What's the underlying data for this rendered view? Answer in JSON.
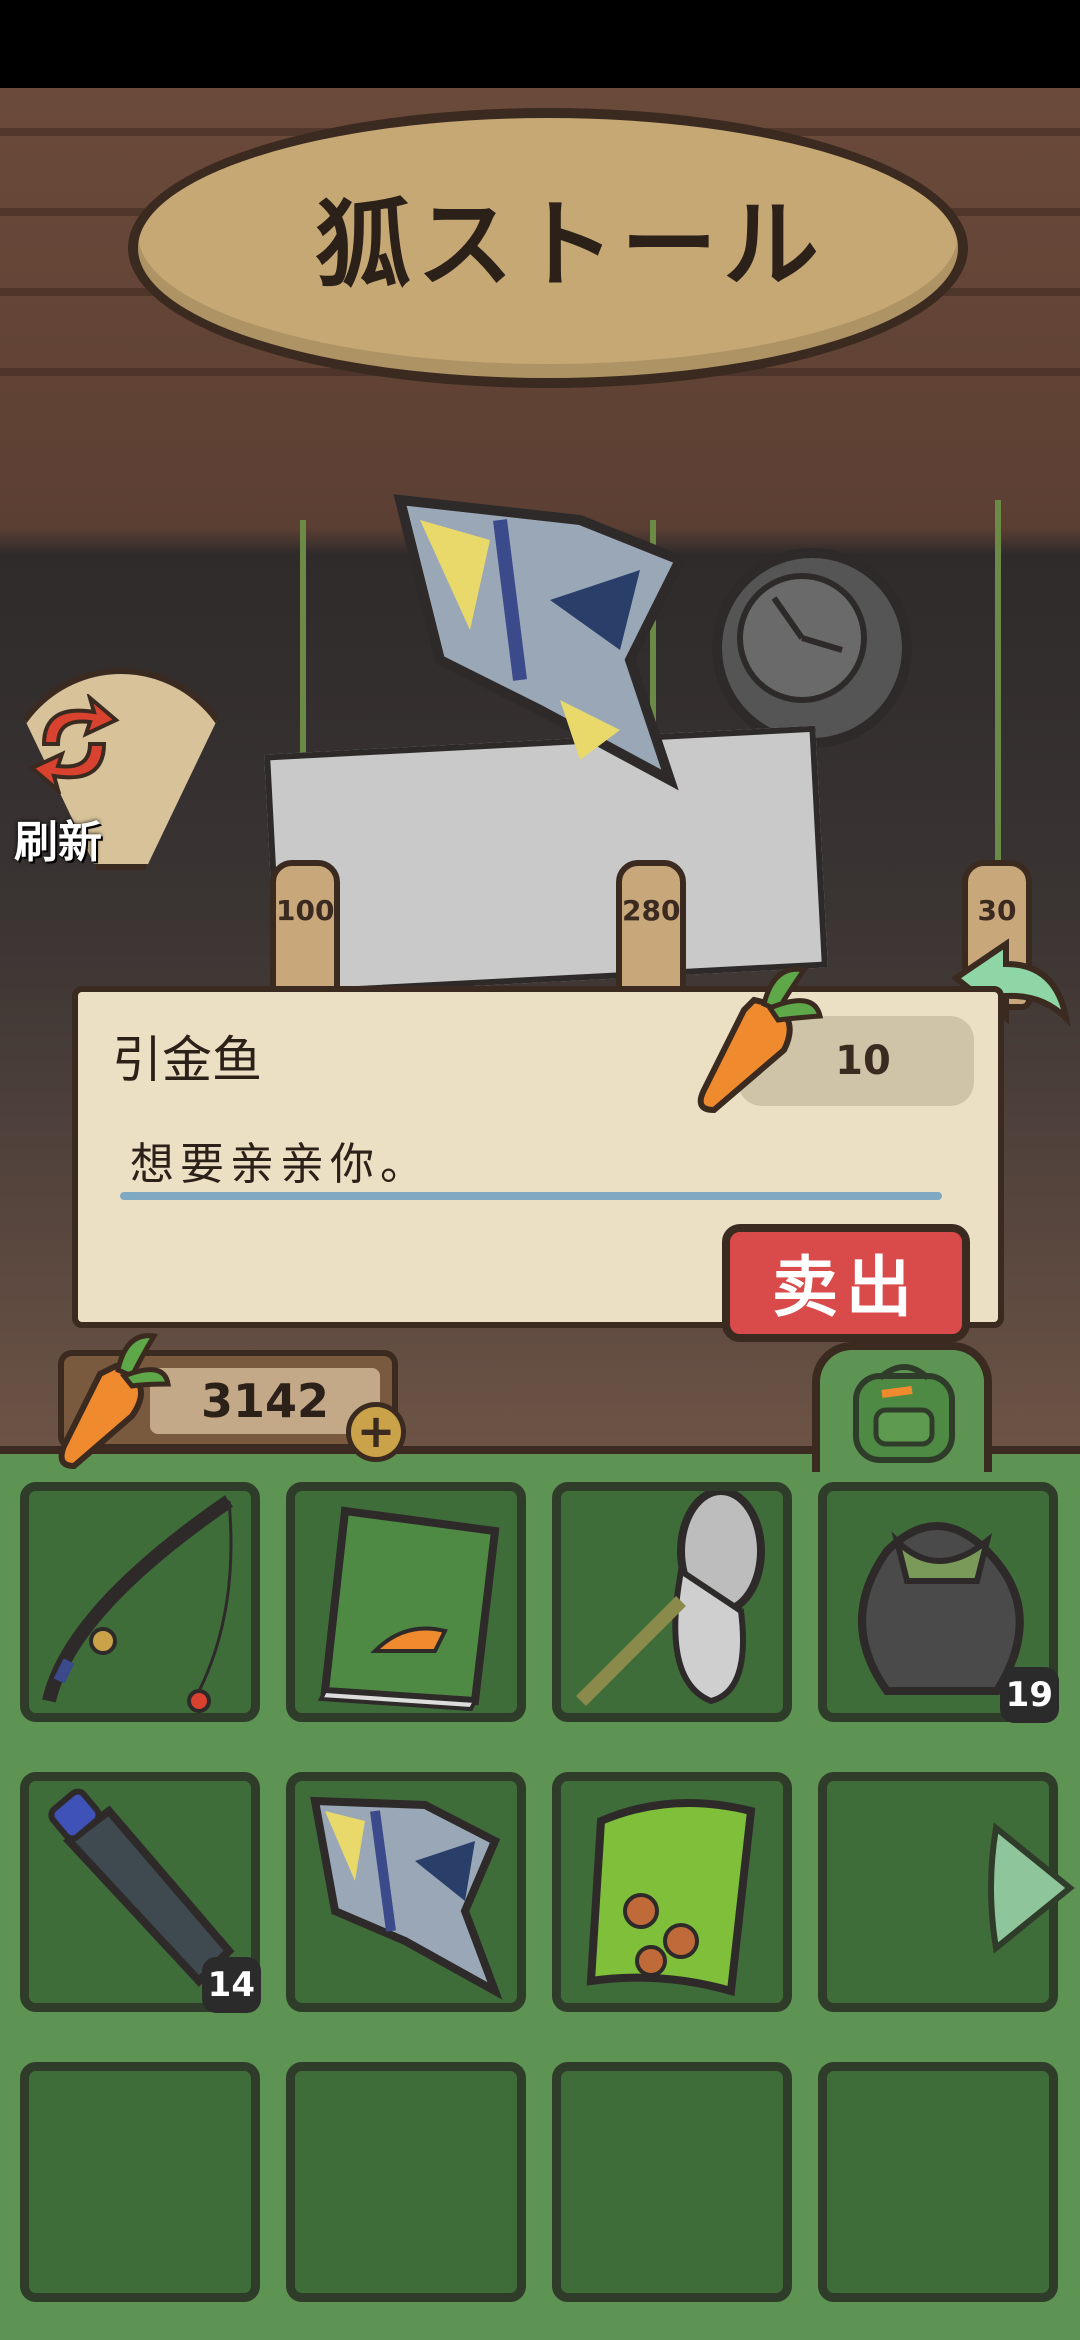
{
  "shop": {
    "sign": "狐ストール",
    "refresh_label": "刷新",
    "tags": [
      "100",
      "280",
      "30"
    ]
  },
  "dialog": {
    "item_name": "引金鱼",
    "price": "10",
    "description": "想要亲亲你。",
    "sell_label": "卖出"
  },
  "wallet": {
    "carrots": "3142",
    "add_label": "+"
  },
  "inventory": {
    "slots": [
      {
        "item": "fishing rod",
        "count": ""
      },
      {
        "item": "The Lord of the Carrots book",
        "count": ""
      },
      {
        "item": "bug net",
        "count": ""
      },
      {
        "item": "trash bag",
        "count": "19"
      },
      {
        "item": "plastic bottle",
        "count": "14"
      },
      {
        "item": "triggerfish",
        "count": ""
      },
      {
        "item": "snack bag",
        "count": ""
      },
      {
        "item": "",
        "count": ""
      },
      {
        "item": "",
        "count": ""
      },
      {
        "item": "",
        "count": ""
      },
      {
        "item": "",
        "count": ""
      },
      {
        "item": "",
        "count": ""
      }
    ],
    "book_title": "THE LORD OF THE CARROTS"
  },
  "colors": {
    "sell_button": "#d94b4b",
    "bag_green": "#5e9453",
    "slot_green": "#3f6d39",
    "panel_cream": "#ece0c4"
  }
}
